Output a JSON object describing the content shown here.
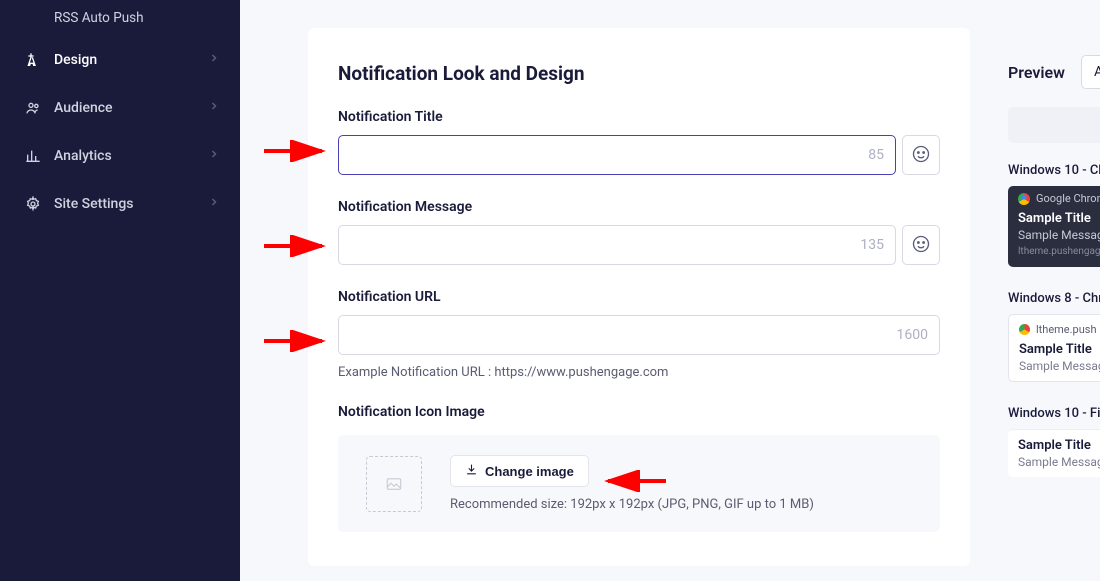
{
  "sidebar": {
    "top_item": "RSS Auto Push",
    "items": [
      {
        "label": "Design",
        "icon": "cursor-icon",
        "active": true
      },
      {
        "label": "Audience",
        "icon": "people-icon",
        "active": false
      },
      {
        "label": "Analytics",
        "icon": "chart-icon",
        "active": false
      },
      {
        "label": "Site Settings",
        "icon": "gear-icon",
        "active": false
      }
    ]
  },
  "main": {
    "title": "Notification Look and Design",
    "fields": {
      "title": {
        "label": "Notification Title",
        "value": "",
        "counter": "85"
      },
      "message": {
        "label": "Notification Message",
        "value": "",
        "counter": "135"
      },
      "url": {
        "label": "Notification URL",
        "value": "",
        "counter": "1600",
        "helper": "Example Notification URL : https://www.pushengage.com"
      },
      "icon": {
        "label": "Notification Icon Image",
        "button": "Change image",
        "hint": "Recommended size: 192px x 192px (JPG, PNG, GIF up to 1 MB)"
      }
    }
  },
  "preview": {
    "title": "Preview",
    "tab": "A",
    "sections": [
      {
        "label": "Windows 10 - Ch",
        "type": "chrome",
        "header": "Google Chrom",
        "title": "Sample Title",
        "msg": "Sample Messag",
        "via": "ltheme.pushengag"
      },
      {
        "label": "Windows 8 - Chr",
        "type": "win8",
        "header": "ltheme.push",
        "title": "Sample Title",
        "msg": "Sample Message"
      },
      {
        "label": "Windows 10 - Fi",
        "type": "firefox",
        "title": "Sample Title",
        "msg": "Sample Message"
      }
    ]
  }
}
